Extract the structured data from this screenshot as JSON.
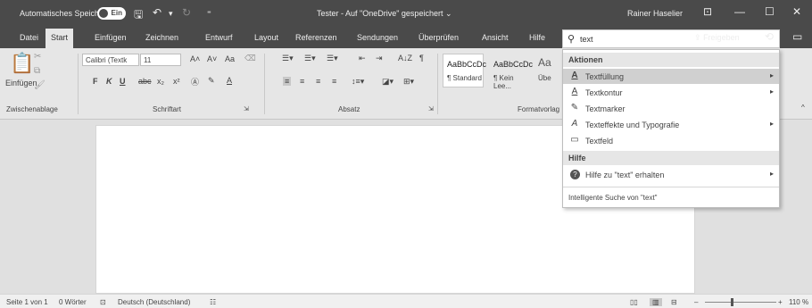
{
  "titlebar": {
    "autosave_label": "Automatisches Speichern",
    "autosave_state": "Ein",
    "doc_title": "Tester - Auf \"OneDrive\" gespeichert",
    "doc_title_chevron": "⌄",
    "user": "Rainer Haselier",
    "qa_icons": [
      "save-icon",
      "undo-icon",
      "redo-icon",
      "customize-icon"
    ],
    "window_buttons": [
      "ribbon-display-icon",
      "minimize-icon",
      "maximize-icon",
      "close-icon"
    ]
  },
  "tabs": {
    "items": [
      "Datei",
      "Start",
      "Einfügen",
      "Zeichnen",
      "Entwurf",
      "Layout",
      "Referenzen",
      "Sendungen",
      "Überprüfen",
      "Ansicht",
      "Hilfe"
    ],
    "active": "Start"
  },
  "search": {
    "value": "text"
  },
  "share_label": "Freigeben",
  "ribbon": {
    "clipboard": {
      "paste_label": "Einfügen",
      "group_label": "Zwischenablage"
    },
    "font": {
      "font_name": "Calibri (Textk",
      "font_size": "11",
      "grow": "A˄",
      "shrink": "A˅",
      "case": "Aa",
      "row2": [
        "F",
        "K",
        "U",
        "abc",
        "x₂",
        "x²"
      ],
      "group_label": "Schriftart"
    },
    "paragraph": {
      "group_label": "Absatz",
      "sort": "A↓Z",
      "pilcrow": "¶"
    },
    "styles": {
      "preview": "AaBbCcDc",
      "tiles": [
        "¶ Standard",
        "¶ Kein Lee...",
        "Übe"
      ],
      "third_preview": "Aa",
      "group_label": "Formatvorlag"
    }
  },
  "dropdown": {
    "section_actions": "Aktionen",
    "actions": [
      {
        "icon": "A",
        "label": "Textfüllung",
        "has_submenu": true,
        "selected": true
      },
      {
        "icon": "A",
        "label": "Textkontur",
        "has_submenu": true,
        "selected": false
      },
      {
        "icon": "✎",
        "label": "Textmarker",
        "has_submenu": false,
        "selected": false
      },
      {
        "icon": "A",
        "label": "Texteffekte und Typografie",
        "has_submenu": true,
        "selected": false
      },
      {
        "icon": "▭",
        "label": "Textfeld",
        "has_submenu": false,
        "selected": false
      }
    ],
    "section_help": "Hilfe",
    "help_item": {
      "icon": "?",
      "label": "Hilfe zu \"text\" erhalten",
      "has_submenu": true
    },
    "footer": "Intelligente Suche von \"text\""
  },
  "statusbar": {
    "page": "Seite 1 von 1",
    "words": "0 Wörter",
    "language": "Deutsch (Deutschland)",
    "zoom": "110 %",
    "zoom_minus": "–",
    "zoom_plus": "+"
  },
  "colors": {
    "chrome": "#4a4a4a",
    "ribbon": "#e6e6e6",
    "doc_bg": "#e0e0e0"
  }
}
